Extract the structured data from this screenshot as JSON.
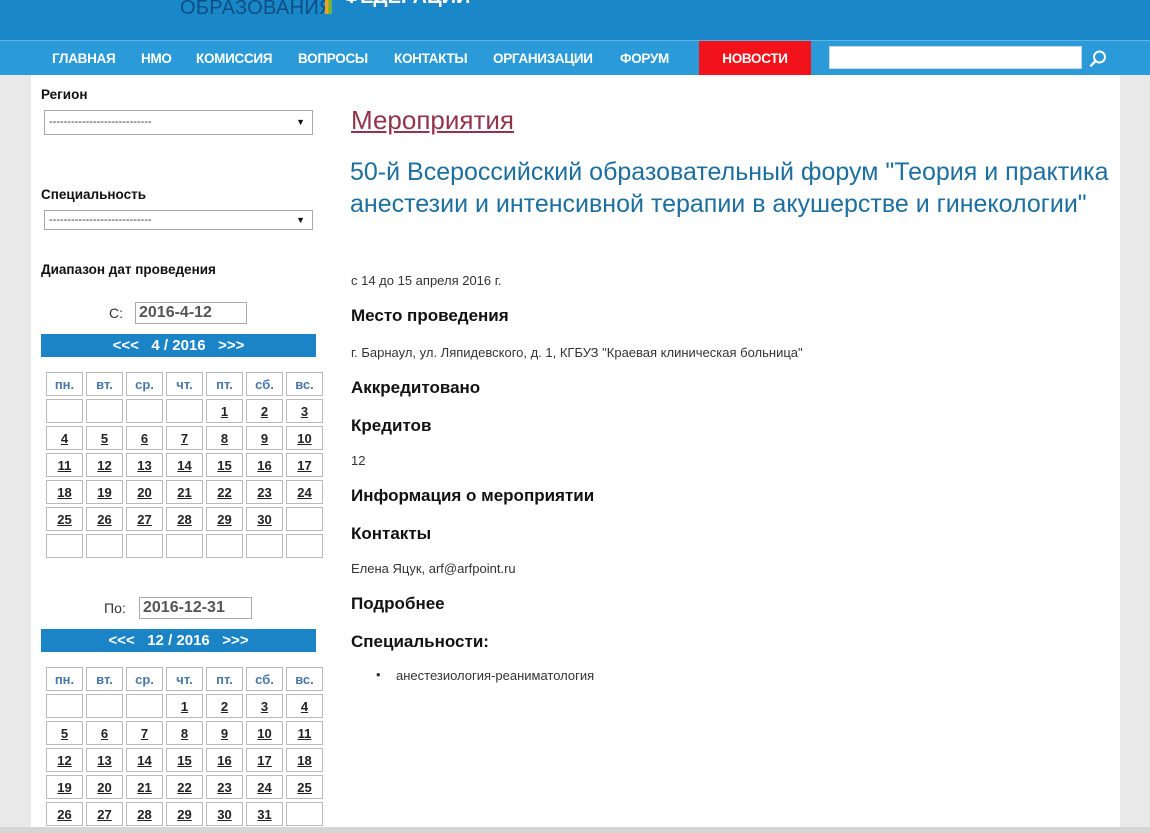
{
  "header": {
    "logo_text": "ОБРАЗОВАНИЯ",
    "logo_text2": "ФЕДЕРАЦИИ"
  },
  "nav": {
    "items": [
      "ГЛАВНАЯ",
      "НМО",
      "КОМИССИЯ",
      "ВОПРОСЫ",
      "КОНТАКТЫ",
      "ОРГАНИЗАЦИИ",
      "ФОРУМ"
    ],
    "news": "НОВОСТИ",
    "search_placeholder": ""
  },
  "sidebar": {
    "region_label": "Регион",
    "region_value": "----------------------------",
    "specialty_label": "Специальность",
    "specialty_value": "----------------------------",
    "date_range_label": "Диапазон дат проведения",
    "from_label": "С:",
    "from_value": "2016-4-12",
    "to_label": "По:",
    "to_value": "2016-12-31",
    "weekdays": [
      "пн.",
      "вт.",
      "ср.",
      "чт.",
      "пт.",
      "сб.",
      "вс."
    ],
    "cal1": {
      "prev": "<<<",
      "title": "4 / 2016",
      "next": ">>>",
      "weeks": [
        [
          "",
          "",
          "",
          "",
          "1",
          "2",
          "3"
        ],
        [
          "4",
          "5",
          "6",
          "7",
          "8",
          "9",
          "10"
        ],
        [
          "11",
          "12",
          "13",
          "14",
          "15",
          "16",
          "17"
        ],
        [
          "18",
          "19",
          "20",
          "21",
          "22",
          "23",
          "24"
        ],
        [
          "25",
          "26",
          "27",
          "28",
          "29",
          "30",
          ""
        ],
        [
          "",
          "",
          "",
          "",
          "",
          "",
          ""
        ]
      ]
    },
    "cal2": {
      "prev": "<<<",
      "title": "12 / 2016",
      "next": ">>>",
      "weeks": [
        [
          "",
          "",
          "",
          "1",
          "2",
          "3",
          "4"
        ],
        [
          "5",
          "6",
          "7",
          "8",
          "9",
          "10",
          "11"
        ],
        [
          "12",
          "13",
          "14",
          "15",
          "16",
          "17",
          "18"
        ],
        [
          "19",
          "20",
          "21",
          "22",
          "23",
          "24",
          "25"
        ],
        [
          "26",
          "27",
          "28",
          "29",
          "30",
          "31",
          ""
        ]
      ]
    }
  },
  "content": {
    "section_link": "Мероприятия",
    "event_title": "50-й Всероссийский образовательный форум \"Теория и практика анестезии и интенсивной терапии в акушерстве и гинекологии\"",
    "dates": "с 14 до 15 апреля 2016 г.",
    "place_heading": "Место проведения",
    "place": "г. Барнаул, ул. Ляпидевского, д. 1, КГБУЗ \"Краевая клиническая больница\"",
    "accredited_heading": "Аккредитовано",
    "credits_heading": "Кредитов",
    "credits": "12",
    "info_heading": "Информация о мероприятии",
    "contacts_heading": "Контакты",
    "contacts": "Елена Яцук, arf@arfpoint.ru",
    "details_heading": "Подробнее",
    "specialties_heading": "Специальности:",
    "specialties": [
      "анестезиология-реаниматология"
    ]
  }
}
